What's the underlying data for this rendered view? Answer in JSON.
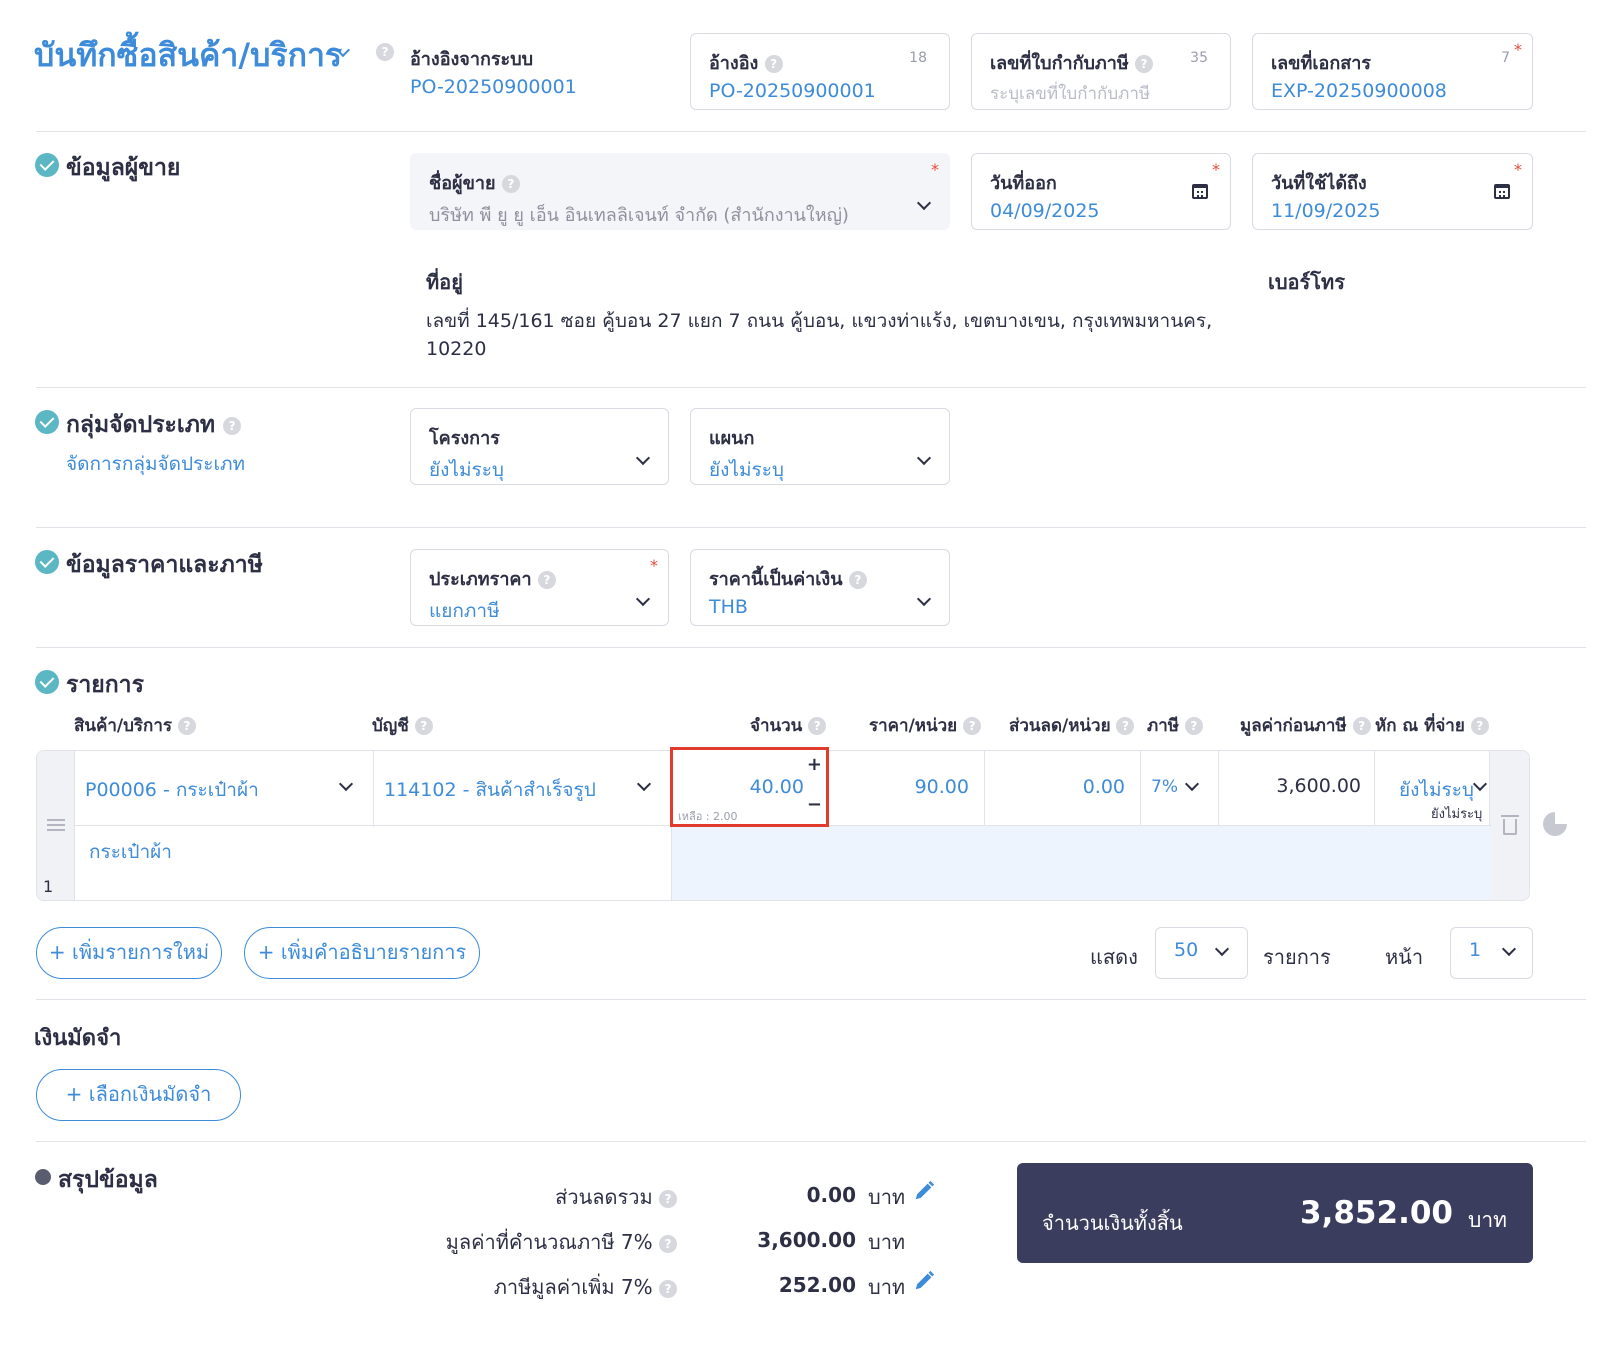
{
  "header": {
    "title": "บันทึกซื้อสินค้า/บริการ",
    "system_ref_label": "อ้างอิงจากระบบ",
    "system_ref_value": "PO-20250900001",
    "ref": {
      "label": "อ้างอิง",
      "count": "18",
      "value": "PO-20250900001"
    },
    "tax_invoice": {
      "label": "เลขที่ใบกำกับภาษี",
      "count": "35",
      "placeholder": "ระบุเลขที่ใบกำกับภาษี"
    },
    "doc_no": {
      "label": "เลขที่เอกสาร",
      "count": "7",
      "value": "EXP-20250900008"
    }
  },
  "vendor": {
    "section_title": "ข้อมูลผู้ขาย",
    "name_label": "ชื่อผู้ขาย",
    "name_value": "บริษัท พี ยู ยู เอ็น อินเทลลิเจนท์ จำกัด (สำนักงานใหญ่)",
    "issue_date_label": "วันที่ออก",
    "issue_date": "04/09/2025",
    "valid_until_label": "วันที่ใช้ได้ถึง",
    "valid_until": "11/09/2025",
    "address_label": "ที่อยู่",
    "address_line1": "เลขที่ 145/161 ซอย คู้บอน 27 แยก 7 ถนน คู้บอน, แขวงท่าแร้ง, เขตบางเขน, กรุงเทพมหานคร,",
    "address_line2": "10220",
    "phone_label": "เบอร์โทร"
  },
  "classification": {
    "section_title": "กลุ่มจัดประเภท",
    "manage_link": "จัดการกลุ่มจัดประเภท",
    "project_label": "โครงการ",
    "project_value": "ยังไม่ระบุ",
    "department_label": "แผนก",
    "department_value": "ยังไม่ระบุ"
  },
  "pricing": {
    "section_title": "ข้อมูลราคาและภาษี",
    "price_type_label": "ประเภทราคา",
    "price_type_value": "แยกภาษี",
    "currency_label": "ราคานี้เป็นค่าเงิน",
    "currency_value": "THB"
  },
  "items": {
    "section_title": "รายการ",
    "columns": {
      "product": "สินค้า/บริการ",
      "account": "บัญชี",
      "qty": "จำนวน",
      "unit_price": "ราคา/หน่วย",
      "discount": "ส่วนลด/หน่วย",
      "tax": "ภาษี",
      "pretax": "มูลค่าก่อนภาษี",
      "withholding": "หัก ณ ที่จ่าย"
    },
    "rows": [
      {
        "index": "1",
        "product": "P00006 - กระเป๋าผ้า",
        "account": "114102 - สินค้าสำเร็จรูป",
        "qty": "40.00",
        "remaining": "เหลือ : 2.00",
        "unit_price": "90.00",
        "discount": "0.00",
        "tax": "7%",
        "pretax": "3,600.00",
        "withholding": "ยังไม่ระบุ",
        "withholding_sub": "ยังไม่ระบุ",
        "description": "กระเป๋าผ้า"
      }
    ],
    "add_item": "+ เพิ่มรายการใหม่",
    "add_desc": "+ เพิ่มคำอธิบายรายการ",
    "show_label": "แสดง",
    "page_size": "50",
    "items_label": "รายการ",
    "page_label": "หน้า",
    "page_value": "1"
  },
  "deposit": {
    "section_title": "เงินมัดจำ",
    "select_button": "+ เลือกเงินมัดจำ"
  },
  "summary": {
    "section_title": "สรุปข้อมูล",
    "discount_label": "ส่วนลดรวม",
    "discount_value": "0.00",
    "taxable_label": "มูลค่าที่คำนวณภาษี 7%",
    "taxable_value": "3,600.00",
    "vat_label": "ภาษีมูลค่าเพิ่ม 7%",
    "vat_value": "252.00",
    "unit": "บาท",
    "total_label": "จำนวนเงินทั้งสิ้น",
    "total_value": "3,852.00"
  }
}
